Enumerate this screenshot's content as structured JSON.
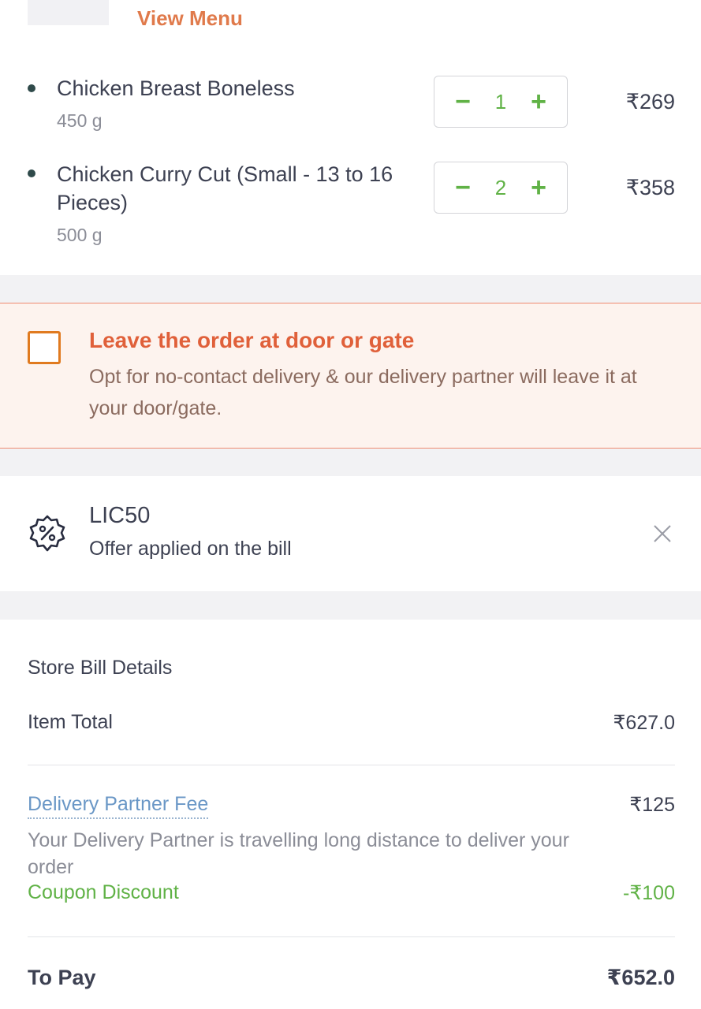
{
  "header": {
    "view_menu": "View Menu"
  },
  "items": [
    {
      "name": "Chicken Breast Boneless",
      "weight": "450 g",
      "qty": "1",
      "price": "₹269"
    },
    {
      "name": "Chicken Curry Cut (Small - 13 to 16 Pieces)",
      "weight": "500 g",
      "qty": "2",
      "price": "₹358"
    }
  ],
  "stepper": {
    "minus": "−",
    "plus": "+"
  },
  "no_contact": {
    "title": "Leave the order at door or gate",
    "description": "Opt for no-contact delivery & our delivery partner will leave it at your door/gate."
  },
  "coupon": {
    "code": "LIC50",
    "description": "Offer applied on the bill"
  },
  "bill": {
    "title": "Store Bill Details",
    "item_total_label": "Item Total",
    "item_total_value": "₹627.0",
    "delivery_fee_label": "Delivery Partner Fee",
    "delivery_fee_value": "₹125",
    "delivery_fee_note": "Your Delivery Partner is travelling long distance to deliver your order",
    "coupon_discount_label": "Coupon Discount",
    "coupon_discount_value": "-₹100",
    "to_pay_label": "To Pay",
    "to_pay_value": "₹652.0"
  },
  "colors": {
    "accent_orange": "#e07a4b",
    "stepper_green": "#60b246",
    "link_blue": "#6a97c6",
    "nocontact_bg": "#fdf3ee"
  }
}
